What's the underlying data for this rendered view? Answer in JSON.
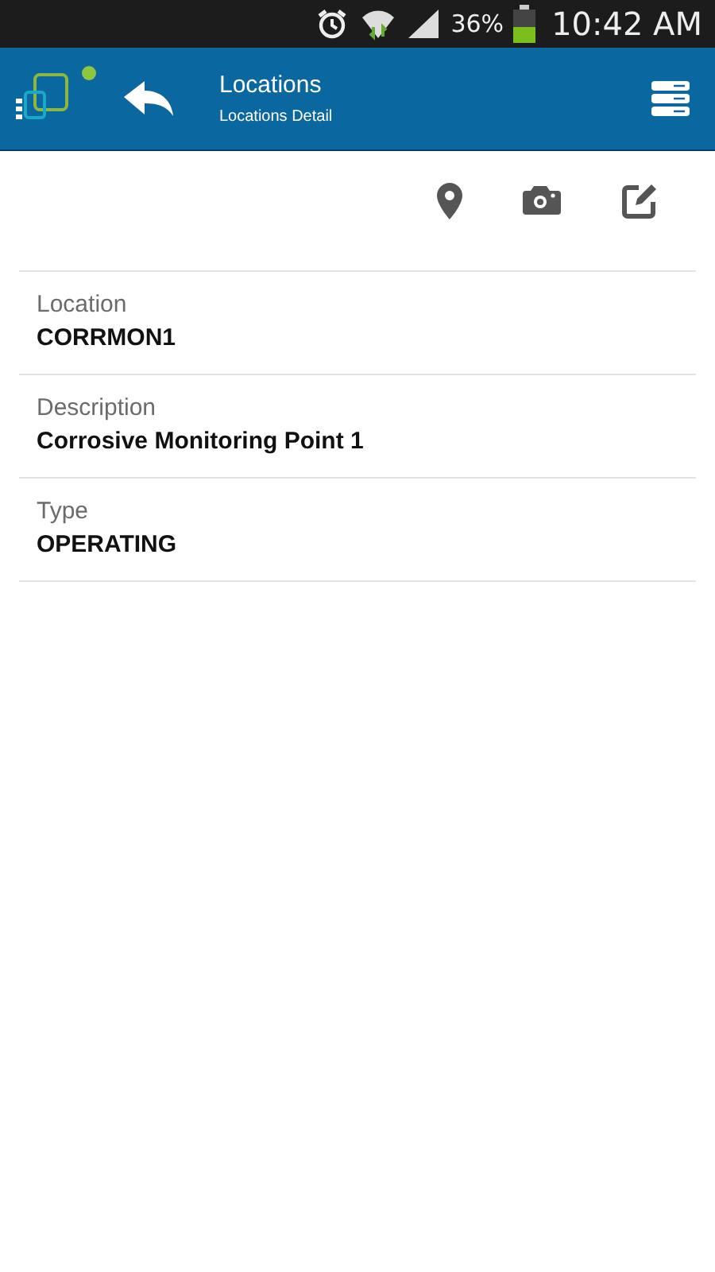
{
  "status_bar": {
    "battery": "36%",
    "time": "10:42 AM"
  },
  "header": {
    "title": "Locations",
    "subtitle": "Locations Detail"
  },
  "actions": [
    {
      "kind": "map"
    },
    {
      "kind": "camera"
    },
    {
      "kind": "edit"
    }
  ],
  "fields": [
    {
      "label": "Location",
      "value": "CORRMON1"
    },
    {
      "label": "Description",
      "value": "Corrosive Monitoring Point 1"
    },
    {
      "label": "Type",
      "value": "OPERATING"
    }
  ]
}
